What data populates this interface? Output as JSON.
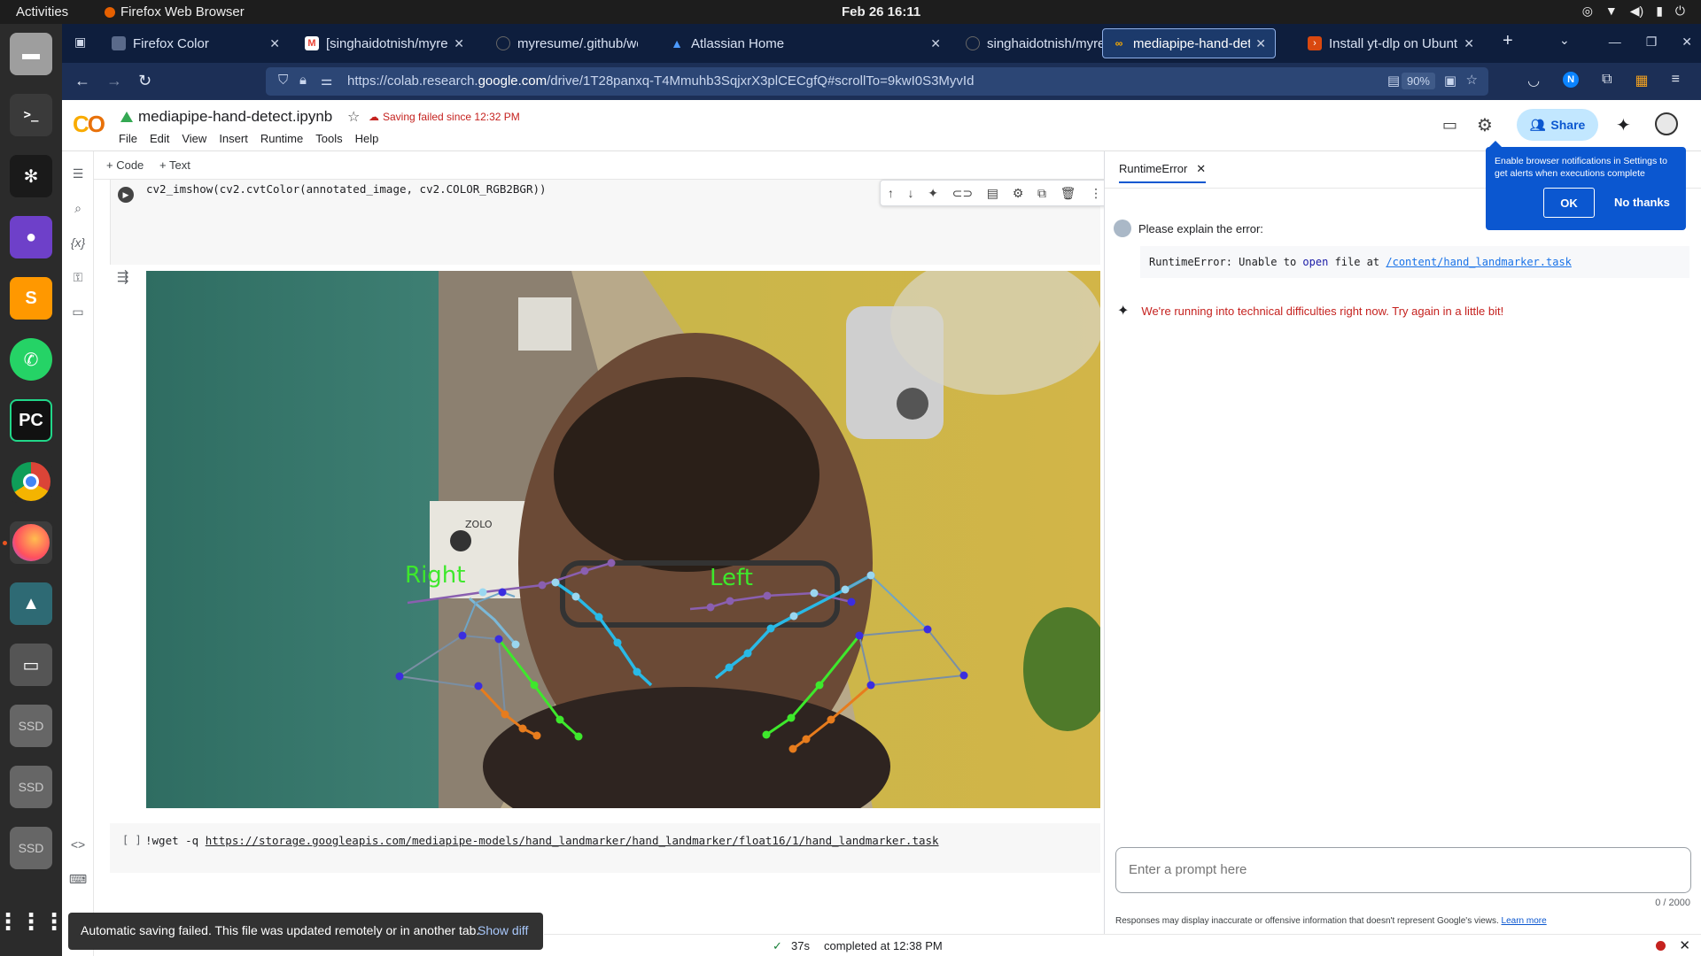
{
  "system": {
    "activities": "Activities",
    "app_name": "Firefox Web Browser",
    "clock": "Feb 26  16:11"
  },
  "dock": {
    "items": [
      "files",
      "terminal",
      "chatgpt",
      "github-desktop",
      "sublime-text",
      "whatsapp",
      "pycharm",
      "chrome",
      "firefox",
      "app-center",
      "disks",
      "ssd",
      "ssd",
      "ssd",
      "show-apps"
    ],
    "ssd_label": "SSD"
  },
  "browser": {
    "tabs": [
      {
        "title": "Firefox Color"
      },
      {
        "title": "[singhaidotnish/myresum"
      },
      {
        "title": "myresume/.github/workf"
      },
      {
        "title": "Atlassian Home"
      },
      {
        "title": "singhaidotnish/myresum"
      },
      {
        "title": "mediapipe-hand-detect.ip"
      },
      {
        "title": "Install yt-dlp on Ubuntu u"
      }
    ],
    "url_prefix": "https://colab.research.",
    "url_host": "google.com",
    "url_suffix": "/drive/1T28panxq-T4Mmuhb3SqjxrX3plCECgfQ#scrollTo=9kwI0S3MyvId",
    "zoom": "90%"
  },
  "colab": {
    "notebook_name": "mediapipe-hand-detect.ipynb",
    "saving_status": "Saving failed since 12:32 PM",
    "menu": [
      "File",
      "Edit",
      "View",
      "Insert",
      "Runtime",
      "Tools",
      "Help"
    ],
    "share_label": "Share",
    "add_code": "+ Code",
    "add_text": "+ Text",
    "cell1_code": "cv2_imshow(cv2.cvtColor(annotated_image, cv2.COLOR_RGB2BGR))",
    "cell2_prefix": "!wget -q ",
    "cell2_link": "https://storage.googleapis.com/mediapipe-models/hand_landmarker/hand_landmarker/float16/1/hand_landmarker.task",
    "cell2_bracket": "[ ]",
    "image_labels": {
      "right": "Right",
      "left": "Left"
    }
  },
  "toast": {
    "message": "Automatic saving failed. This file was updated remotely or in another tab.",
    "action": "Show diff"
  },
  "status": {
    "check": "✓",
    "elapsed": "37s",
    "completed": "completed at 12:38 PM"
  },
  "gemini": {
    "tab_title": "RuntimeError",
    "user_message": "Please explain the error:",
    "error_label": "RuntimeError:",
    "error_text_1": "Unable to",
    "error_kw": "open",
    "error_text_2": "file at",
    "error_path": "/content/hand_landmarker.task",
    "ai_response": "We're running into technical difficulties right now. Try again in a little bit!",
    "prompt_placeholder": "Enter a prompt here",
    "counter": "0 / 2000",
    "disclaimer": "Responses may display inaccurate or offensive information that doesn't represent Google's views.",
    "learn_more": "Learn more"
  },
  "notification": {
    "text": "Enable browser notifications in Settings to get alerts when executions complete",
    "ok": "OK",
    "no": "No thanks"
  }
}
